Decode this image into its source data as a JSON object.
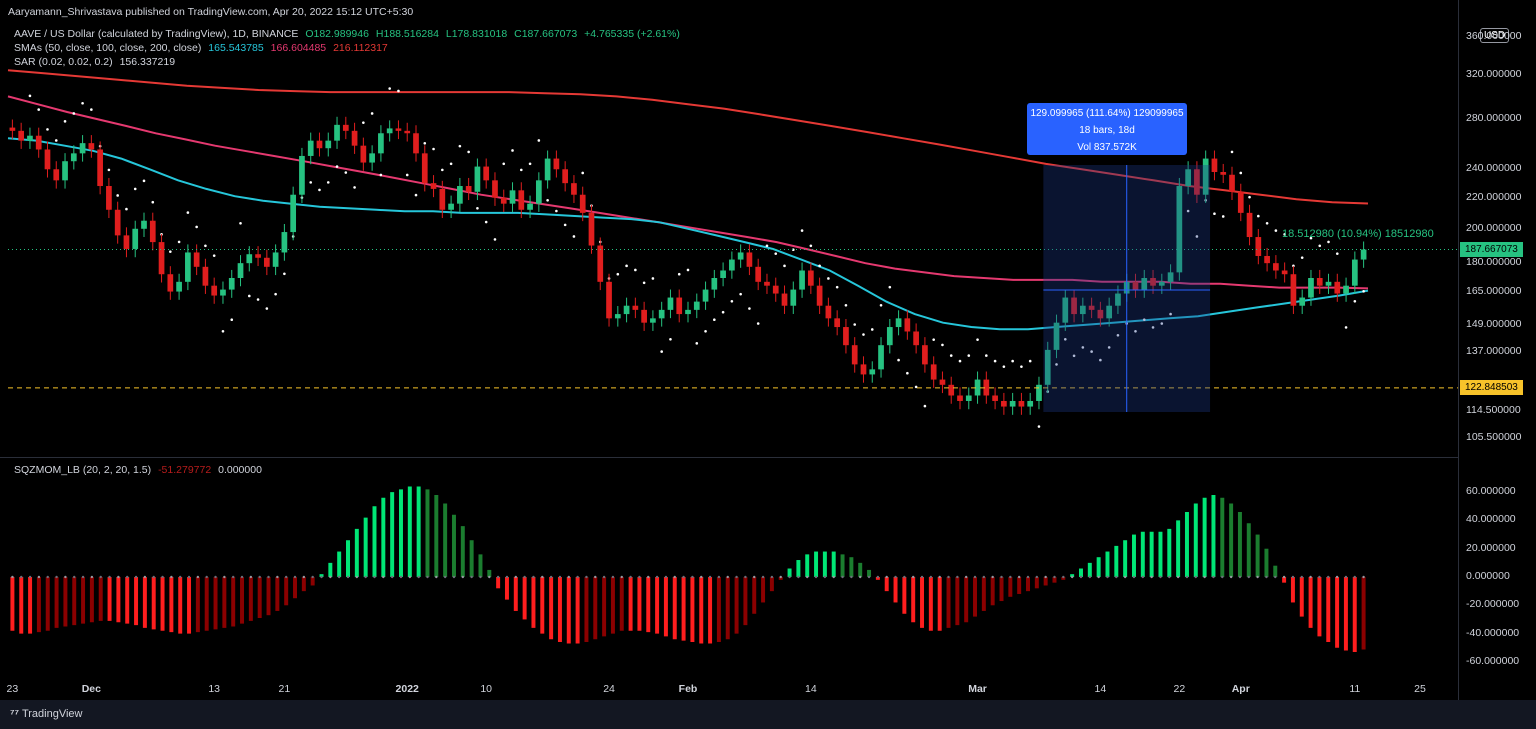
{
  "header": {
    "published": "Aaryamann_Shrivastava published on TradingView.com, Apr 20, 2022 15:12 UTC+5:30",
    "symbol": "AAVE / US Dollar (calculated by TradingView), 1D, BINANCE",
    "open": "O182.989946",
    "high": "H188.516284",
    "low": "L178.831018",
    "close": "C187.667073",
    "change": "+4.765335 (+2.61%)",
    "sma_label": "SMAs (50, close, 100, close, 200, close)",
    "sma50": "165.543785",
    "sma100": "166.604485",
    "sma200": "216.112317",
    "sar_label": "SAR (0.02, 0.02, 0.2)",
    "sar_value": "156.337219",
    "sqz_label": "SQZMOM_LB (20, 2, 20, 1.5)",
    "sqz_value1": "-51.279772",
    "sqz_value2": "0.000000",
    "currency": "USD"
  },
  "measure": {
    "line1": "129.099965 (111.64%) 129099965",
    "line2": "18 bars, 18d",
    "line3": "Vol 837.572K"
  },
  "range_label": "18.512980 (10.94%) 18512980",
  "price_labels": {
    "last": "187.667073",
    "hline": "122.848503"
  },
  "colors": {
    "up": "#26c281",
    "down": "#e01e1e",
    "sma50": "#26c6da",
    "sma100": "#e53970",
    "sma200": "#e53935",
    "hline": "#f7c32a",
    "measure": "#2962ff"
  },
  "footer": {
    "brand": "TradingView"
  },
  "chart_data": [
    {
      "type": "candlestick",
      "title": "AAVE / US Dollar (calculated by TradingView), 1D, BINANCE",
      "yscale": "log",
      "ylim": [
        100,
        370
      ],
      "y_ticks": [
        "360.000000",
        "320.000000",
        "280.000000",
        "240.000000",
        "220.000000",
        "200.000000",
        "180.000000",
        "165.000000",
        "149.000000",
        "137.000000",
        "114.500000",
        "105.500000"
      ],
      "x_ticks": [
        "23",
        "Dec",
        "13",
        "21",
        "2022",
        "10",
        "24",
        "Feb",
        "14",
        "Mar",
        "14",
        "22",
        "Apr",
        "11",
        "25"
      ],
      "x_bold": [
        "Dec",
        "2022",
        "Feb",
        "Mar",
        "Apr"
      ],
      "horizontal_line": 122.848503,
      "closes": [
        270,
        262,
        266,
        255,
        240,
        232,
        246,
        252,
        260,
        255,
        228,
        212,
        196,
        188,
        200,
        205,
        192,
        174,
        165,
        170,
        186,
        178,
        168,
        163,
        166,
        172,
        180,
        185,
        183,
        178,
        186,
        198,
        222,
        250,
        262,
        256,
        262,
        275,
        270,
        258,
        245,
        252,
        268,
        272,
        270,
        268,
        252,
        230,
        226,
        212,
        216,
        228,
        224,
        242,
        232,
        220,
        216,
        225,
        212,
        216,
        232,
        248,
        240,
        230,
        222,
        210,
        190,
        170,
        152,
        154,
        158,
        156,
        150,
        152,
        156,
        162,
        154,
        156,
        160,
        166,
        172,
        176,
        182,
        186,
        178,
        170,
        168,
        164,
        158,
        166,
        176,
        168,
        158,
        152,
        148,
        140,
        132,
        128,
        130,
        140,
        148,
        152,
        146,
        140,
        132,
        126,
        124,
        120,
        118,
        120,
        126,
        120,
        118,
        116,
        118,
        116,
        118,
        124,
        138,
        150,
        162,
        154,
        158,
        156,
        152,
        158,
        164,
        170,
        166,
        172,
        168,
        170,
        175,
        228,
        240,
        222,
        248,
        238,
        236,
        224,
        210,
        195,
        184,
        180,
        176,
        174,
        158,
        162,
        172,
        168,
        170,
        164,
        168,
        182,
        187.67
      ],
      "sma50": [
        264,
        262,
        258,
        254,
        248,
        240,
        232,
        226,
        221,
        218,
        216,
        214,
        213,
        212,
        211,
        211,
        210,
        210,
        210,
        209,
        208,
        207,
        206,
        204,
        200,
        196,
        192,
        188,
        182,
        176,
        168,
        160,
        154,
        150,
        148,
        147,
        147,
        148,
        149,
        150,
        151,
        152,
        153,
        155,
        157,
        159,
        161,
        163,
        165.5
      ],
      "sma100": [
        300,
        293,
        286,
        280,
        274,
        268,
        263,
        258,
        254,
        250,
        246,
        242,
        238,
        234,
        230,
        226,
        222,
        219,
        216,
        213,
        210,
        207,
        204,
        201,
        198,
        195,
        192,
        188,
        184,
        180,
        177,
        175,
        173,
        172,
        171,
        171,
        171,
        170,
        170,
        170,
        169,
        169,
        168,
        167,
        167,
        167,
        166.6
      ],
      "sma200": [
        325,
        322,
        319,
        316,
        313,
        310,
        308,
        306,
        305,
        304,
        304,
        304,
        304,
        304,
        304,
        303,
        302,
        300,
        297,
        293,
        289,
        284,
        279,
        274,
        269,
        264,
        259,
        254,
        249,
        244,
        240,
        236,
        232,
        228,
        225,
        222,
        219,
        217,
        216.1
      ]
    },
    {
      "type": "bar",
      "title": "SQZMOM_LB (20, 2, 20, 1.5)",
      "ylim": [
        -70,
        70
      ],
      "y_ticks": [
        "60.000000",
        "40.000000",
        "20.000000",
        "0.000000",
        "-20.000000",
        "-40.000000",
        "-60.000000"
      ],
      "values": [
        -38,
        -40,
        -40,
        -39,
        -38,
        -36,
        -35,
        -34,
        -33,
        -32,
        -31,
        -31,
        -32,
        -33,
        -34,
        -36,
        -37,
        -38,
        -39,
        -40,
        -40,
        -39,
        -38,
        -37,
        -36,
        -35,
        -33,
        -31,
        -29,
        -27,
        -24,
        -20,
        -15,
        -10,
        -6,
        2,
        10,
        18,
        26,
        34,
        42,
        50,
        56,
        60,
        62,
        64,
        64,
        62,
        58,
        52,
        44,
        36,
        26,
        16,
        5,
        -8,
        -16,
        -24,
        -30,
        -36,
        -40,
        -44,
        -46,
        -47,
        -47,
        -46,
        -44,
        -42,
        -40,
        -38,
        -38,
        -38,
        -39,
        -40,
        -42,
        -44,
        -45,
        -46,
        -47,
        -47,
        -46,
        -44,
        -40,
        -34,
        -26,
        -18,
        -10,
        -2,
        6,
        12,
        16,
        18,
        18,
        18,
        16,
        14,
        10,
        5,
        -2,
        -10,
        -18,
        -26,
        -32,
        -36,
        -38,
        -38,
        -36,
        -34,
        -32,
        -28,
        -24,
        -20,
        -17,
        -14,
        -12,
        -10,
        -8,
        -6,
        -4,
        -2,
        2,
        6,
        10,
        14,
        18,
        22,
        26,
        30,
        32,
        32,
        32,
        34,
        40,
        46,
        52,
        56,
        58,
        56,
        52,
        46,
        38,
        30,
        20,
        8,
        -4,
        -18,
        -28,
        -36,
        -42,
        -46,
        -50,
        -52,
        -53,
        -51.28
      ],
      "colors_key": [
        "lime: rising above 0",
        "green: falling above 0",
        "red: falling below 0",
        "maroon: rising below 0"
      ]
    }
  ]
}
